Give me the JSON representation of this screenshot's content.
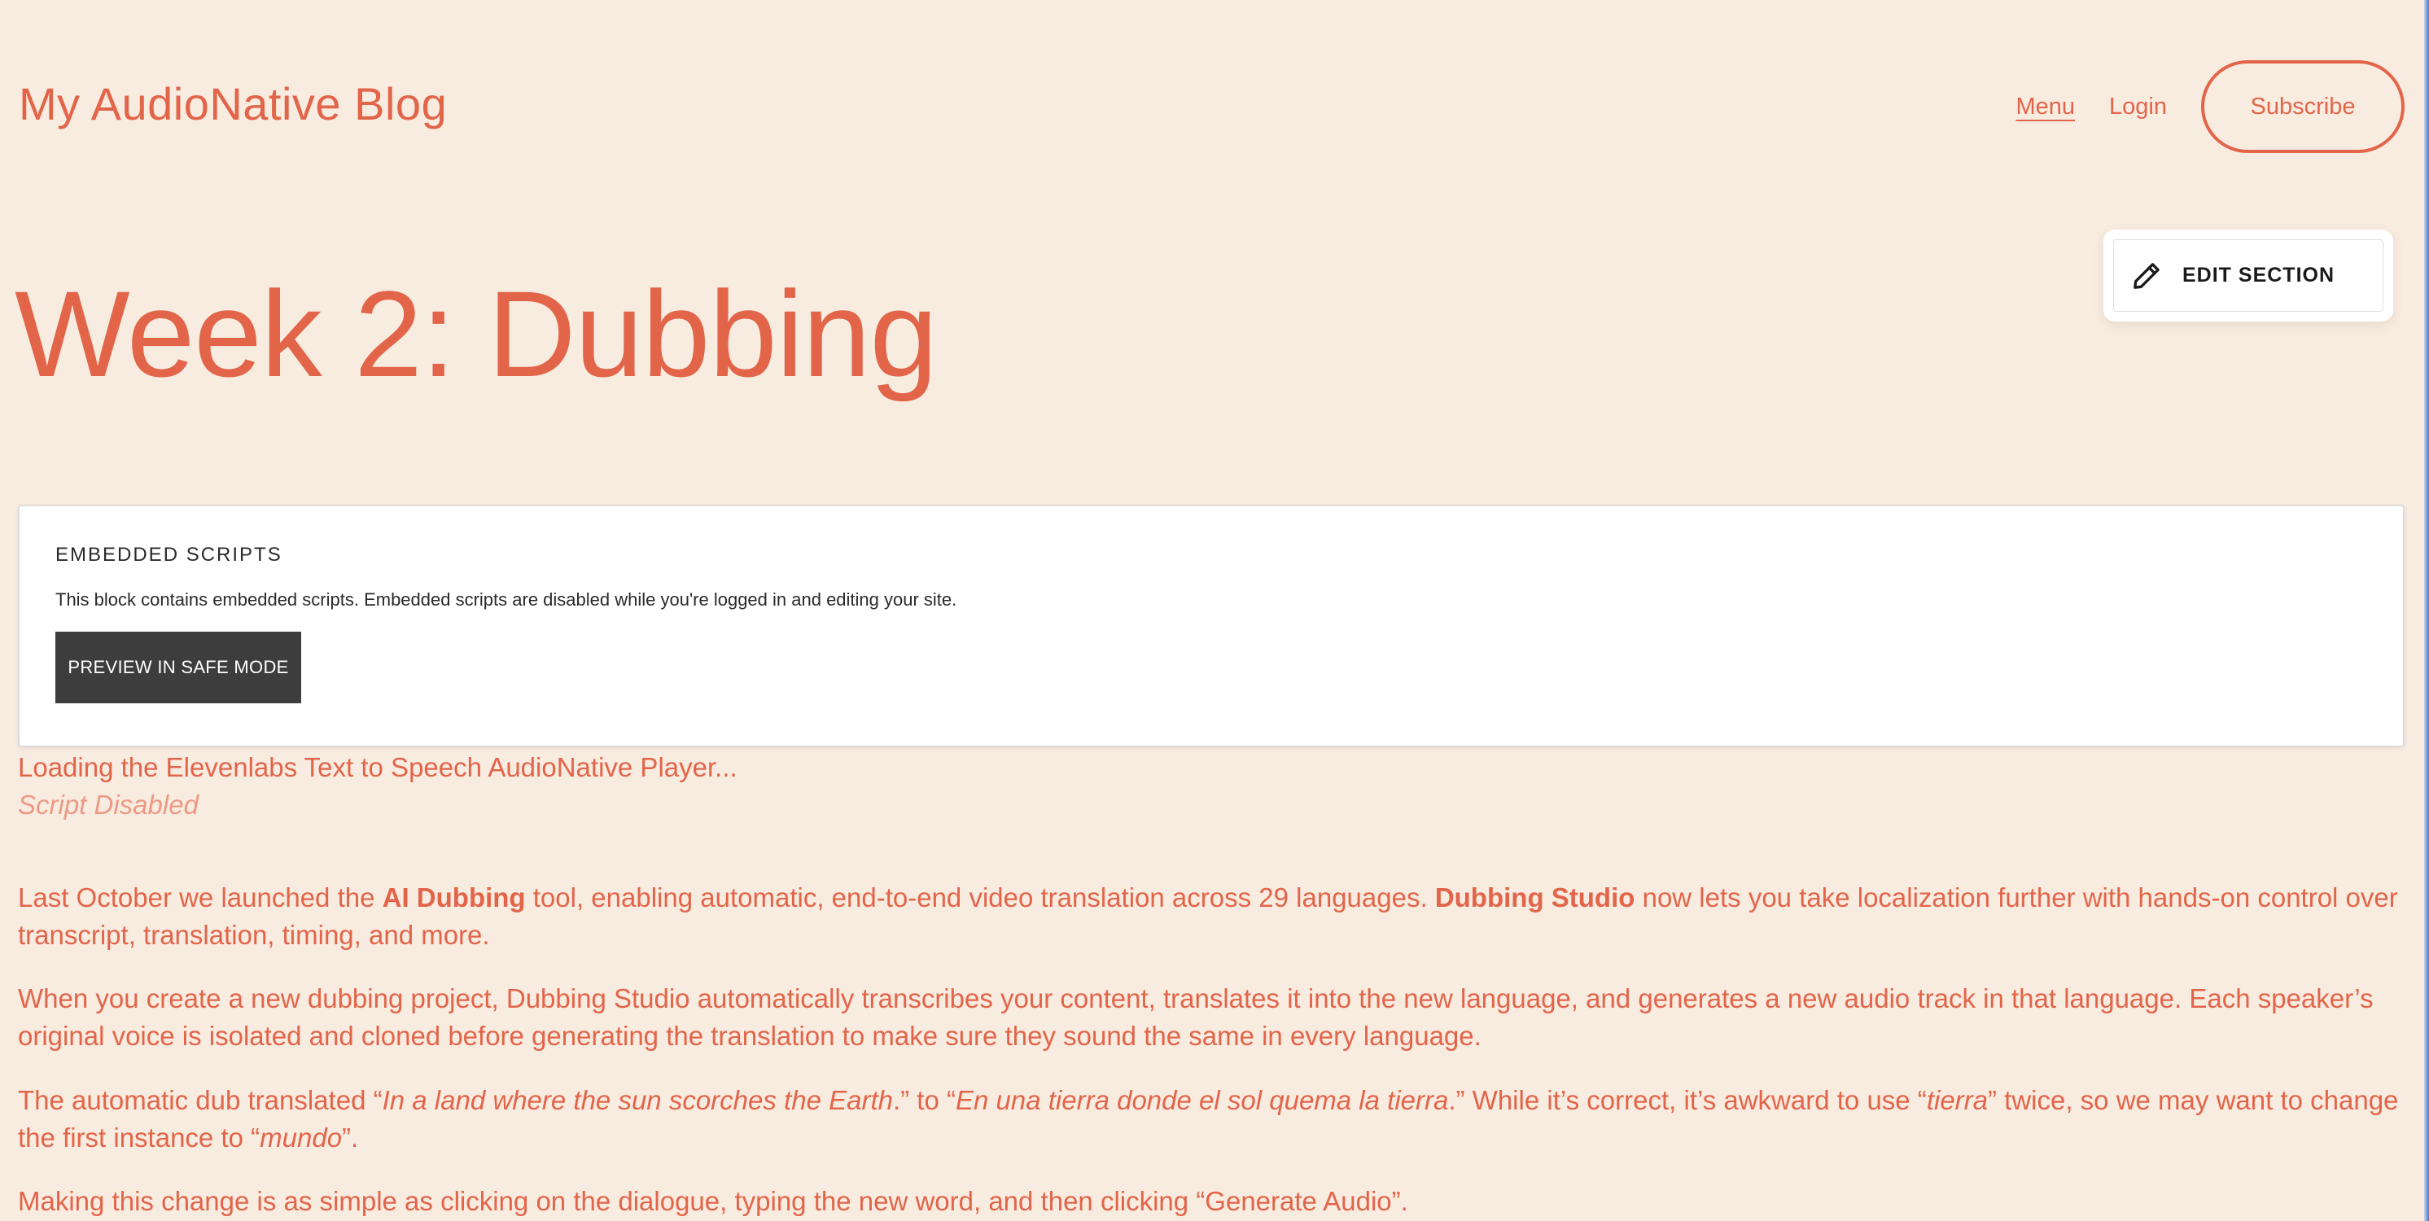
{
  "header": {
    "site_title": "My AudioNative Blog",
    "nav": {
      "menu": "Menu",
      "login": "Login",
      "subscribe": "Subscribe"
    }
  },
  "edit_section": {
    "label": "EDIT SECTION",
    "icon": "pencil-icon"
  },
  "hero": {
    "title": "Week 2: Dubbing"
  },
  "embed": {
    "title": "EMBEDDED SCRIPTS",
    "description": "This block contains embedded scripts. Embedded scripts are disabled while you're logged in and editing your site.",
    "button": "PREVIEW IN SAFE MODE"
  },
  "player": {
    "loading": "Loading the Elevenlabs Text to Speech AudioNative Player...",
    "disabled": "Script Disabled"
  },
  "article": {
    "p1": {
      "a": "Last October we launched the ",
      "b1": "AI Dubbing",
      "c": " tool, enabling automatic, end-to-end video translation across 29 languages. ",
      "b2": "Dubbing Studio",
      "d": " now lets you take localization further with hands-on control over transcript, translation, timing, and more."
    },
    "p2": "When you create a new dubbing project, Dubbing Studio automatically transcribes your content, translates it into the new language, and generates a new audio track in that language. Each speaker’s original voice is isolated and cloned before generating the translation to make sure they sound the same in every language.",
    "p3": {
      "a": "The automatic dub translated “",
      "i1": "In a land where the sun scorches the Earth",
      "b": ".” to “",
      "i2": "En una tierra donde el sol quema la tierra",
      "c": ".” While it’s correct, it’s awkward to use “",
      "i3": "tierra",
      "d": "” twice, so we may want to change the first instance to “",
      "i4": "mundo",
      "e": "”."
    },
    "p4": "Making this change is as simple as clicking on the dialogue, typing the new word, and then clicking “Generate Audio”."
  },
  "colors": {
    "background": "#f8ebdf",
    "accent": "#e2654a",
    "muted_accent": "#ec9a86",
    "embed_button": "#3d3d3d"
  }
}
